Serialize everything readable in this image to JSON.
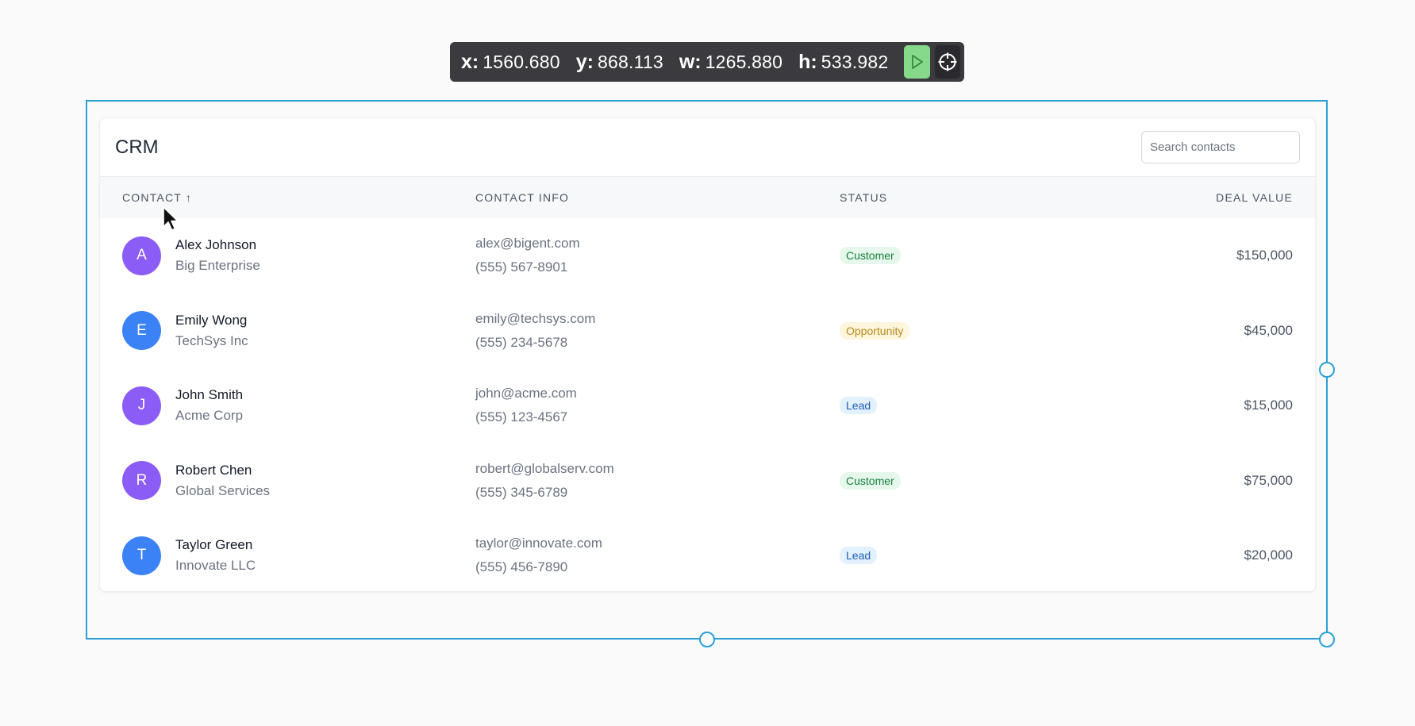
{
  "toolbar": {
    "x_label": "x:",
    "x_value": "1560.680",
    "y_label": "y:",
    "y_value": "868.113",
    "w_label": "w:",
    "w_value": "1265.880",
    "h_label": "h:",
    "h_value": "533.982",
    "play_icon": "play-icon",
    "target_icon": "crosshair-icon"
  },
  "card": {
    "title": "CRM",
    "search_placeholder": "Search contacts"
  },
  "table": {
    "headers": {
      "contact": "CONTACT ↑",
      "contact_info": "CONTACT INFO",
      "status": "STATUS",
      "deal_value": "DEAL VALUE"
    },
    "rows": [
      {
        "initial": "A",
        "name": "Alex Johnson",
        "company": "Big Enterprise",
        "email": "alex@bigent.com",
        "phone": "(555) 567-8901",
        "status": "Customer",
        "deal": "$150,000"
      },
      {
        "initial": "E",
        "name": "Emily Wong",
        "company": "TechSys Inc",
        "email": "emily@techsys.com",
        "phone": "(555) 234-5678",
        "status": "Opportunity",
        "deal": "$45,000"
      },
      {
        "initial": "J",
        "name": "John Smith",
        "company": "Acme Corp",
        "email": "john@acme.com",
        "phone": "(555) 123-4567",
        "status": "Lead",
        "deal": "$15,000"
      },
      {
        "initial": "R",
        "name": "Robert Chen",
        "company": "Global Services",
        "email": "robert@globalserv.com",
        "phone": "(555) 345-6789",
        "status": "Customer",
        "deal": "$75,000"
      },
      {
        "initial": "T",
        "name": "Taylor Green",
        "company": "Innovate LLC",
        "email": "taylor@innovate.com",
        "phone": "(555) 456-7890",
        "status": "Lead",
        "deal": "$20,000"
      }
    ]
  },
  "colors": {
    "avatar_purple": "#8b5cf6",
    "avatar_blue": "#3b82f6",
    "customer_bg": "#e6f7ec",
    "customer_fg": "#15803d",
    "opportunity_bg": "#fdf6dc",
    "opportunity_fg": "#b7891a",
    "lead_bg": "#e3f0fd",
    "lead_fg": "#1d5fb8",
    "selection": "#2a9fd8"
  }
}
